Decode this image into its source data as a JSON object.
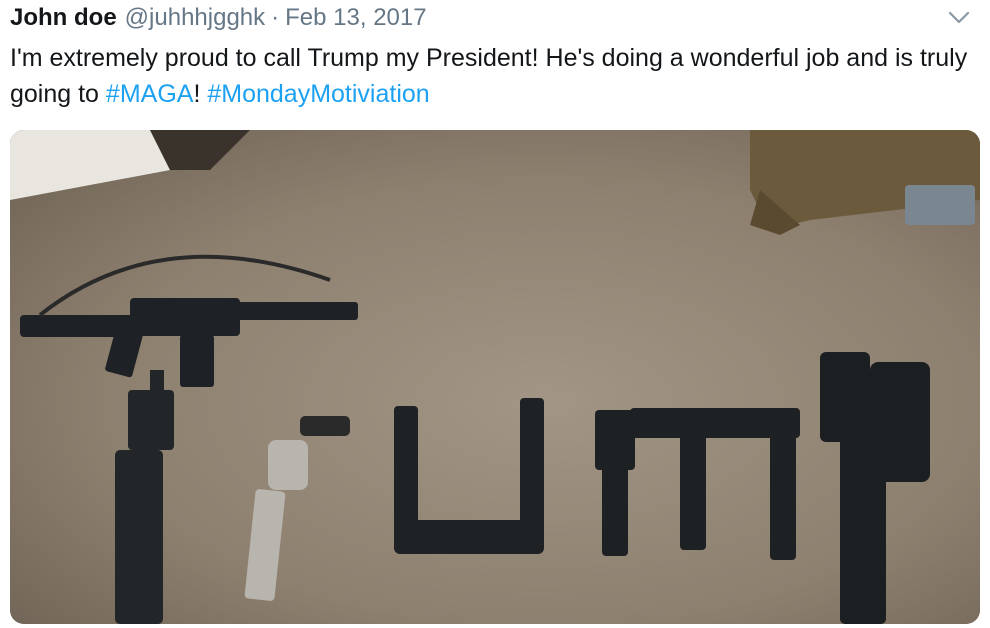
{
  "tweet": {
    "author_name": "John doe",
    "handle": "@juhhhjgghk",
    "separator": "·",
    "date": "Feb 13, 2017",
    "text_part1": "I'm extremely proud to call Trump my President! He's doing a wonderful job and is truly going to ",
    "hashtag1": "#MAGA",
    "text_part2": "! ",
    "hashtag2": "#MondayMotiviation",
    "caret_icon": "chevron-down-icon",
    "link_color": "#1da1f2",
    "text_color": "#14171a",
    "secondary_color": "#657786"
  },
  "media": {
    "description_icon": "photo"
  }
}
